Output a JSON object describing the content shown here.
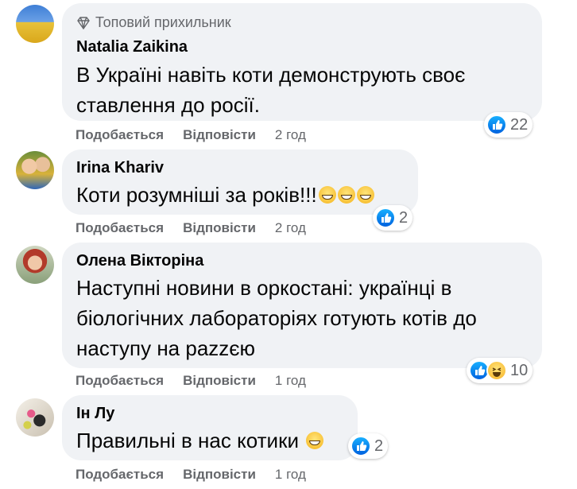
{
  "actions": {
    "like_label": "Подобається",
    "reply_label": "Відповісти"
  },
  "comments": [
    {
      "badge": "Топовий прихильник",
      "badge_icon": "diamond-icon",
      "author": "Natalia Zaikina",
      "text": "В Україні навіть коти демонструють своє ставлення до росії.",
      "reactions": [
        "like"
      ],
      "reaction_count": "22",
      "time": "2 год"
    },
    {
      "author": "Irina Khariv",
      "text": "Коти розумніші за років!!!",
      "emoji": "grin-emoji x3",
      "reactions": [
        "like"
      ],
      "reaction_count": "2",
      "time": "2 год"
    },
    {
      "author": "Олена Вікторіна",
      "text": "Наступні новини в оркостані: українці в біологічних лабораторіях готують котів до наступу на раzzєю",
      "reactions": [
        "like",
        "haha"
      ],
      "reaction_count": "10",
      "time": "1 год"
    },
    {
      "author": "Ін Лу",
      "text": "Правильні в нас котики",
      "emoji": "sweat-smile-emoji",
      "reactions": [
        "like"
      ],
      "reaction_count": "2",
      "time": "1 год"
    }
  ],
  "colors": {
    "bubble": "#f0f2f5",
    "secondary_text": "#65676b",
    "like_blue": "#1877f2"
  }
}
